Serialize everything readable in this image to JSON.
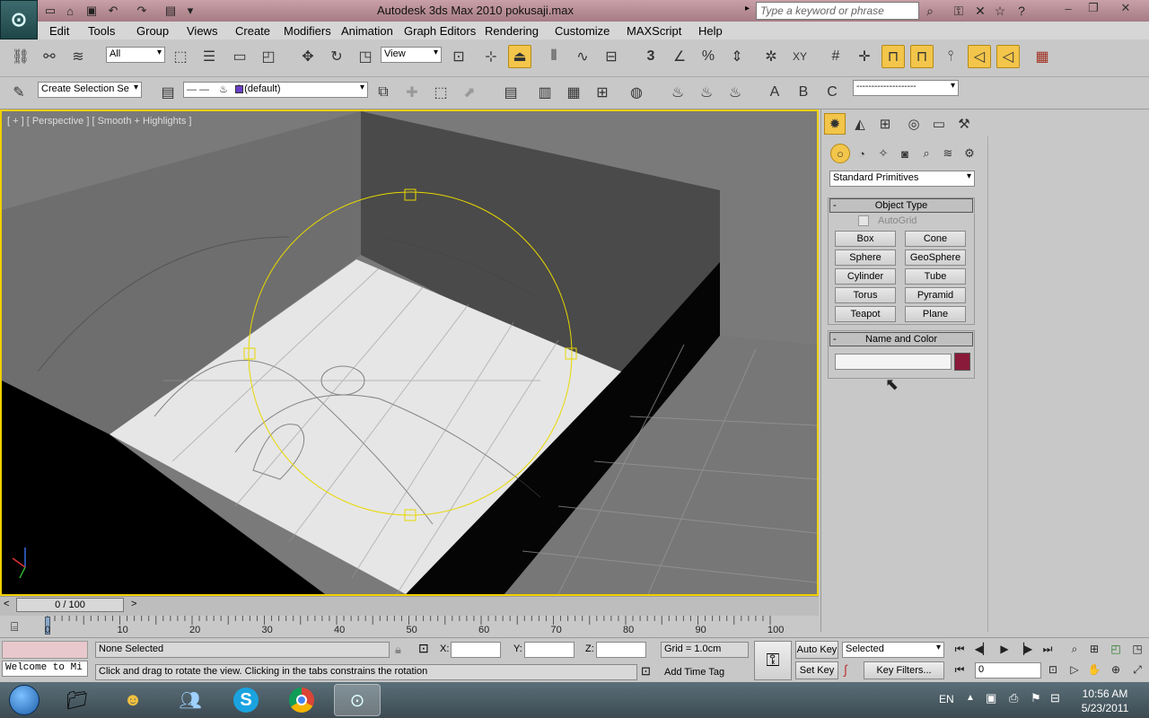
{
  "window": {
    "title": "Autodesk 3ds Max  2010        pokusaji.max",
    "search_placeholder": "Type a keyword or phrase"
  },
  "menu": [
    "Edit",
    "Tools",
    "Group",
    "Views",
    "Create",
    "Modifiers",
    "Animation",
    "Graph Editors",
    "Rendering",
    "Customize",
    "MAXScript",
    "Help"
  ],
  "toolbar1": {
    "selection_filter": "All",
    "ref_coord": "View",
    "snap_label": "3",
    "xy_label": "XY"
  },
  "toolbar2": {
    "named_selection": "Create Selection Se",
    "layer": "0 (default)",
    "line_style": "--------------------"
  },
  "viewport": {
    "label": "[ + ] [ Perspective ] [ Smooth + Highlights ]"
  },
  "command_panel": {
    "category": "Standard Primitives",
    "object_type_title": "Object Type",
    "autogrid": "AutoGrid",
    "buttons": [
      "Box",
      "Cone",
      "Sphere",
      "GeoSphere",
      "Cylinder",
      "Tube",
      "Torus",
      "Pyramid",
      "Teapot",
      "Plane"
    ],
    "name_color_title": "Name and Color",
    "object_color": "#8b1a3a"
  },
  "timeline": {
    "frame_display": "0 / 100",
    "ticks": [
      "0",
      "10",
      "20",
      "30",
      "40",
      "50",
      "60",
      "70",
      "80",
      "90",
      "100"
    ]
  },
  "status": {
    "listener": "Welcome to Mi",
    "selection": "None Selected",
    "prompt": "Click and drag to rotate the view.  Clicking in the tabs constrains the rotation",
    "x_label": "X:",
    "y_label": "Y:",
    "z_label": "Z:",
    "grid": "Grid = 1.0cm",
    "add_time_tag": "Add Time Tag",
    "auto_key": "Auto Key",
    "set_key": "Set Key",
    "key_mode": "Selected",
    "key_filters": "Key Filters...",
    "current_frame": "0"
  },
  "taskbar": {
    "lang": "EN",
    "time": "10:56 AM",
    "date": "5/23/2011"
  },
  "colors": {
    "viewport_border": "#f0d000",
    "active_button": "#f3c54a"
  }
}
